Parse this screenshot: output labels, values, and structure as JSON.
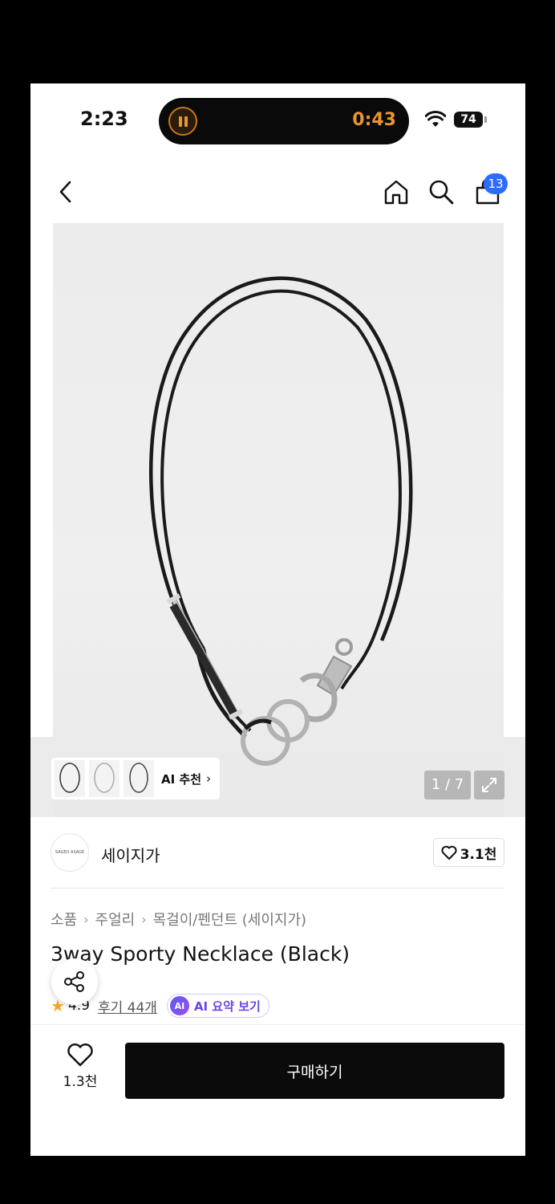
{
  "status_bar": {
    "time": "2:23",
    "timer": "0:43",
    "battery": "74"
  },
  "nav": {
    "back_icon": "chevron-left-icon",
    "home_icon": "home-icon",
    "search_icon": "search-icon",
    "cart_icon": "shopping-bag-icon",
    "cart_count": "13"
  },
  "gallery": {
    "ai_recommend_label": "AI 추천",
    "page_counter": "1 / 7"
  },
  "brand": {
    "logo_text": "SAGEO ASAGE",
    "name": "세이지가",
    "like_count": "3.1천"
  },
  "breadcrumb": [
    "소품",
    "주얼리",
    "목걸이/펜던트 (세이지가)"
  ],
  "product": {
    "title": "3way Sporty Necklace (Black)",
    "rating": "4.9",
    "review_link": "후기 44개",
    "ai_summary_badge": "AI",
    "ai_summary_label": "AI 요약 보기"
  },
  "bottom_bar": {
    "wish_count": "1.3천",
    "buy_label": "구매하기"
  },
  "colors": {
    "accent_blue": "#2d6bff",
    "timer_orange": "#e8952d",
    "ai_purple": "#6b44e8",
    "star": "#f6a623"
  }
}
